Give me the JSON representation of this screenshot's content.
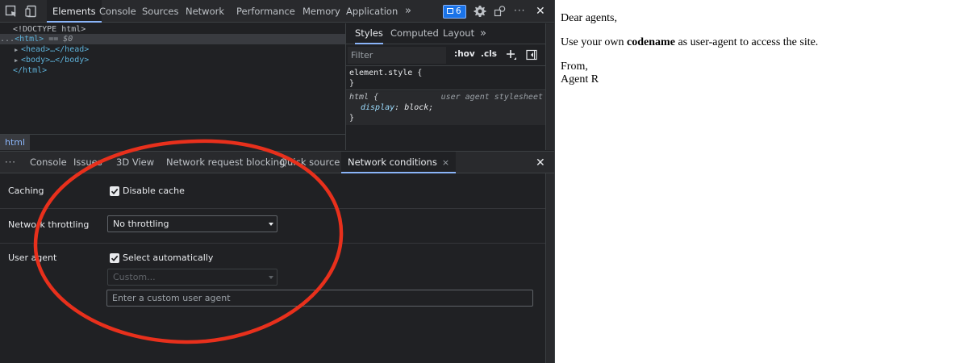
{
  "devtools": {
    "main_tabs": [
      "Elements",
      "Console",
      "Sources",
      "Network",
      "Performance",
      "Memory",
      "Application"
    ],
    "more_tabs_glyph": "»",
    "issues_count": "6",
    "more_options_glyph": "···",
    "close_glyph": "✕",
    "dom_tree": {
      "doctype": "<!DOCTYPE html>",
      "html_open": "<html>",
      "selected_marker": "== $0",
      "head": "<head>…</head>",
      "body": "<body>…</body>",
      "html_close": "</html>",
      "line_prefix": "...",
      "expand_glyph": "▶"
    },
    "breadcrumb": "html",
    "styles": {
      "tabs": [
        "Styles",
        "Computed",
        "Layout"
      ],
      "filter_placeholder": "Filter",
      "hov_label": ":hov",
      "cls_label": ".cls",
      "element_style_selector": "element.style {",
      "close_brace": "}",
      "ua_selector": "html {",
      "ua_source": "user agent stylesheet",
      "ua_property": "display",
      "ua_value": "block;"
    },
    "drawer": {
      "tabs": [
        "Console",
        "Issues",
        "3D View",
        "Network request blocking",
        "Quick source",
        "Network conditions"
      ],
      "active_tab_close": "×"
    },
    "network_conditions": {
      "caching_label": "Caching",
      "disable_cache_label": "Disable cache",
      "disable_cache_checked": true,
      "throttling_label": "Network throttling",
      "throttling_value": "No throttling",
      "user_agent_label": "User agent",
      "select_auto_label": "Select automatically",
      "select_auto_checked": true,
      "custom_select_value": "Custom...",
      "custom_ua_placeholder": "Enter a custom user agent"
    },
    "annotation_color": "#e8301c"
  },
  "page": {
    "greeting": "Dear agents,",
    "message_before": "Use your own ",
    "message_bold": "codename",
    "message_after": " as user-agent to access the site.",
    "signoff": "From,",
    "signature": "Agent R"
  }
}
